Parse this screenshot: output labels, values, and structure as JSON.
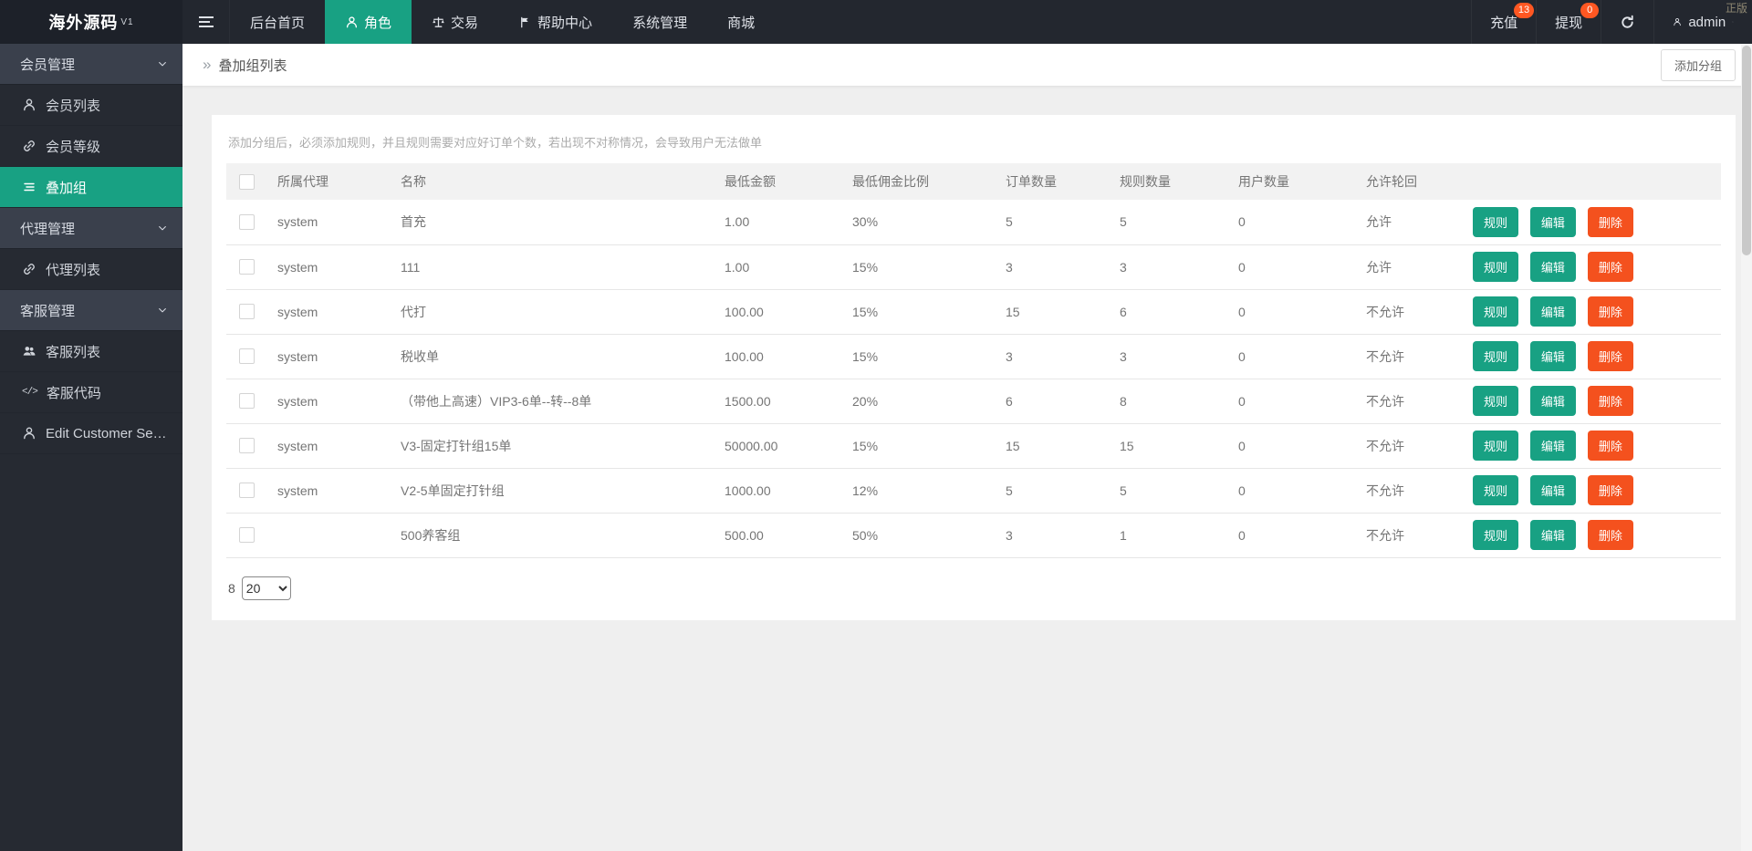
{
  "colors": {
    "accent": "#18A183",
    "danger": "#F4511E",
    "badge": "#FF5722",
    "navbar_bg": "#23272F",
    "sidebar_bg": "#262A32"
  },
  "icons": {
    "breadcrumb_glyph": "»",
    "code_glyph": "</>"
  },
  "navbar": {
    "logo": "海外源码",
    "logo_version": "V1",
    "license": "正版",
    "items": [
      {
        "label": "后台首页"
      },
      {
        "label": "角色"
      },
      {
        "label": "交易"
      },
      {
        "label": "帮助中心"
      },
      {
        "label": "系统管理"
      },
      {
        "label": "商城"
      }
    ],
    "recharge_label": "充值",
    "recharge_badge": "13",
    "withdraw_label": "提现",
    "withdraw_badge": "0",
    "username": "admin"
  },
  "sidebar": {
    "items": [
      {
        "label": "会员管理"
      },
      {
        "label": "会员列表"
      },
      {
        "label": "会员等级"
      },
      {
        "label": "叠加组"
      },
      {
        "label": "代理管理"
      },
      {
        "label": "代理列表"
      },
      {
        "label": "客服管理"
      },
      {
        "label": "客服列表"
      },
      {
        "label": "客服代码"
      },
      {
        "label": "Edit Customer Ser..."
      }
    ]
  },
  "page": {
    "breadcrumb": "叠加组列表",
    "add_group_button": "添加分组",
    "hint": "添加分组后，必须添加规则，并且规则需要对应好订单个数，若出现不对称情况，会导致用户无法做单"
  },
  "table": {
    "headers": {
      "agent": "所属代理",
      "name": "名称",
      "min_amount": "最低金额",
      "min_commission": "最低佣金比例",
      "order_count": "订单数量",
      "rule_count": "规则数量",
      "user_count": "用户数量",
      "allow_loop": "允许轮回"
    },
    "action_labels": {
      "rule": "规则",
      "edit": "编辑",
      "delete": "删除"
    },
    "rows": [
      {
        "agent": "system",
        "name": "首充",
        "min_amount": "1.00",
        "commission": "30%",
        "orders": "5",
        "rules": "5",
        "users": "0",
        "loop": "允许"
      },
      {
        "agent": "system",
        "name": "111",
        "min_amount": "1.00",
        "commission": "15%",
        "orders": "3",
        "rules": "3",
        "users": "0",
        "loop": "允许"
      },
      {
        "agent": "system",
        "name": "代打",
        "min_amount": "100.00",
        "commission": "15%",
        "orders": "15",
        "rules": "6",
        "users": "0",
        "loop": "不允许"
      },
      {
        "agent": "system",
        "name": "税收单",
        "min_amount": "100.00",
        "commission": "15%",
        "orders": "3",
        "rules": "3",
        "users": "0",
        "loop": "不允许"
      },
      {
        "agent": "system",
        "name": "（带他上高速）VIP3-6单--转--8单",
        "min_amount": "1500.00",
        "commission": "20%",
        "orders": "6",
        "rules": "8",
        "users": "0",
        "loop": "不允许"
      },
      {
        "agent": "system",
        "name": "V3-固定打针组15单",
        "min_amount": "50000.00",
        "commission": "15%",
        "orders": "15",
        "rules": "15",
        "users": "0",
        "loop": "不允许"
      },
      {
        "agent": "system",
        "name": "V2-5单固定打针组",
        "min_amount": "1000.00",
        "commission": "12%",
        "orders": "5",
        "rules": "5",
        "users": "0",
        "loop": "不允许"
      },
      {
        "agent": "",
        "name": "500养客组",
        "min_amount": "500.00",
        "commission": "50%",
        "orders": "3",
        "rules": "1",
        "users": "0",
        "loop": "不允许"
      }
    ]
  },
  "pagination": {
    "total": "8",
    "page_size": "20"
  }
}
